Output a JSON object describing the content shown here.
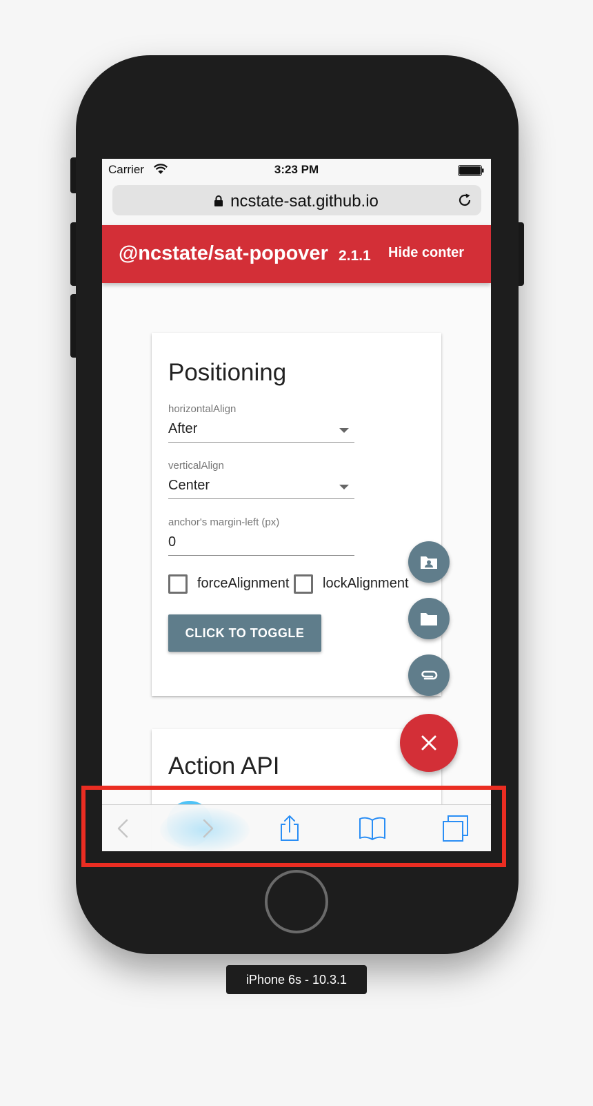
{
  "status_bar": {
    "carrier": "Carrier",
    "time": "3:23 PM"
  },
  "browser": {
    "url": "ncstate-sat.github.io"
  },
  "app_bar": {
    "title": "@ncstate/sat-popover",
    "version": "2.1.1",
    "action": "Hide conter",
    "color": "#d32f37"
  },
  "positioning_card": {
    "title": "Positioning",
    "horizontal_align": {
      "label": "horizontalAlign",
      "value": "After"
    },
    "vertical_align": {
      "label": "verticalAlign",
      "value": "Center"
    },
    "margin_left": {
      "label": "anchor's margin-left (px)",
      "value": "0"
    },
    "force_alignment": {
      "label": "forceAlignment",
      "checked": false
    },
    "lock_alignment": {
      "label": "lockAlignment",
      "checked": false
    },
    "toggle_button": "CLICK TO TOGGLE"
  },
  "action_card": {
    "title": "Action API"
  },
  "speed_dial": {
    "items": [
      "contact-folder-icon",
      "folder-icon",
      "attachment-icon"
    ],
    "main_icon": "close-icon",
    "mini_color": "#607d8b",
    "main_color": "#d32f37"
  },
  "safari_toolbar": {
    "items": [
      "back-icon",
      "forward-icon",
      "share-icon",
      "bookmarks-icon",
      "tabs-icon"
    ],
    "accent": "#2a8ef5",
    "highlight_color": "#ea2d22"
  },
  "device_label": "iPhone 6s - 10.3.1"
}
